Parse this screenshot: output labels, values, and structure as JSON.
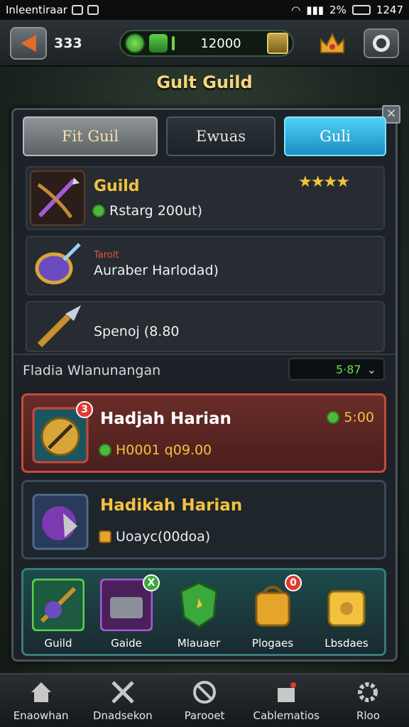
{
  "status_bar": {
    "carrier": "Inleentiraar",
    "battery": "2%",
    "time": "1247"
  },
  "header": {
    "level": "333",
    "currency_value": "12000"
  },
  "page_title": "Gult Guild",
  "tabs": [
    {
      "label": "Fit Guil"
    },
    {
      "label": "Ewuas"
    },
    {
      "label": "Guli"
    }
  ],
  "cards": [
    {
      "title": "Guild",
      "subtitle": "Rstarg 200ut)",
      "stars": "★★★★"
    },
    {
      "tag": "Tarolt",
      "subtitle": "Auraber Harlodad)"
    },
    {
      "subtitle": "Spenoj (8.80"
    }
  ],
  "section": {
    "label": "Fladia Wlanunangan",
    "dropdown_value": "5·87"
  },
  "missions": [
    {
      "title": "Hadjah Harian",
      "badge": "3",
      "subtitle": "H0001 q09.00",
      "time": "5:00"
    },
    {
      "title": "Hadikah Harian",
      "subtitle": "Uoayc(00doa)"
    }
  ],
  "tray": [
    {
      "label": "Guild"
    },
    {
      "label": "Gaide",
      "badge": "X"
    },
    {
      "label": "Mlauaer"
    },
    {
      "label": "Plogaes",
      "badge": "0"
    },
    {
      "label": "Lbsdaes"
    }
  ],
  "bottom_nav": [
    {
      "label": "Enaowhan",
      "icon": "home-icon"
    },
    {
      "label": "Dnadsekon",
      "icon": "swords-icon"
    },
    {
      "label": "Parooet",
      "icon": "forbidden-icon"
    },
    {
      "label": "Cablematios",
      "icon": "castle-icon"
    },
    {
      "label": "Rloo",
      "icon": "gear-icon"
    }
  ]
}
